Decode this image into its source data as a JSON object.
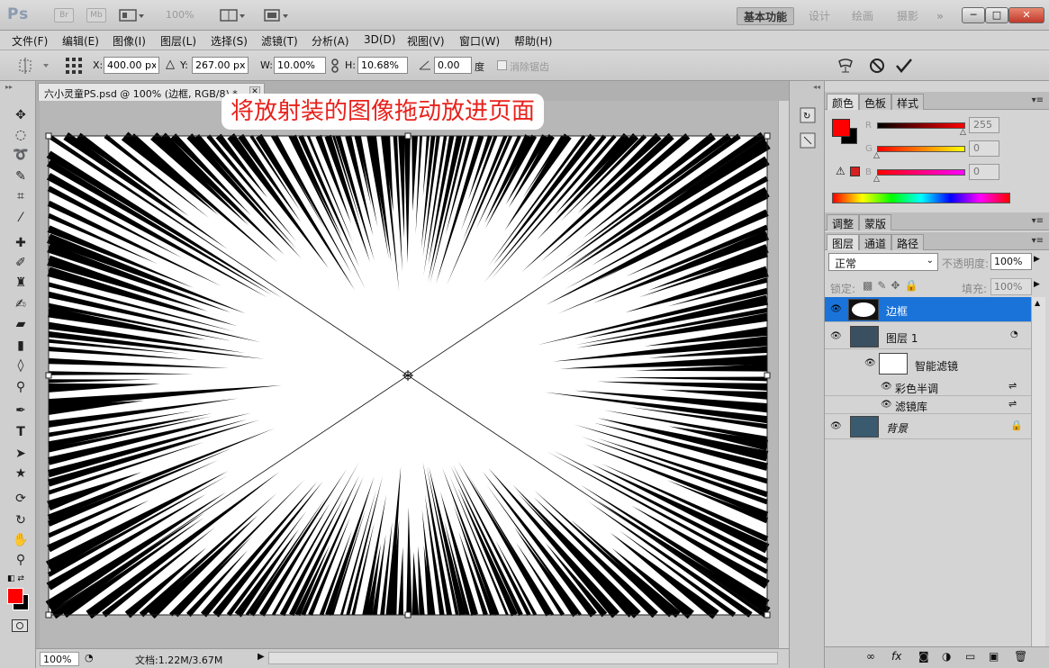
{
  "app": {
    "logo": "Ps",
    "bridge_label": "Br",
    "minibridge_label": "Mb",
    "zoom": "100%",
    "workspaces": [
      "基本功能",
      "设计",
      "绘画",
      "摄影"
    ],
    "more": "»",
    "win_min": "─",
    "win_max": "□",
    "win_close": "✕"
  },
  "menu": [
    "文件(F)",
    "编辑(E)",
    "图像(I)",
    "图层(L)",
    "选择(S)",
    "滤镜(T)",
    "分析(A)",
    "3D(D)",
    "视图(V)",
    "窗口(W)",
    "帮助(H)"
  ],
  "options": {
    "x_label": "X:",
    "x_value": "400.00 px",
    "y_label": "Y:",
    "y_value": "267.00 px",
    "w_label": "W:",
    "w_value": "10.00%",
    "h_label": "H:",
    "h_value": "10.68%",
    "angle_value": "0.00",
    "angle_unit": "度",
    "antialias_label": "消除锯齿"
  },
  "document": {
    "tab_title": "六小灵童PS.psd @ 100% (边框, RGB/8) *",
    "annotation": "将放射装的图像拖动放进页面",
    "status_zoom": "100%",
    "status_doc": "文档:1.22M/3.67M"
  },
  "color_panel": {
    "tabs": [
      "颜色",
      "色板",
      "样式"
    ],
    "r_label": "R",
    "g_label": "G",
    "b_label": "B",
    "r_value": "255",
    "g_value": "0",
    "b_value": "0",
    "foreground": "#ff0000",
    "background": "#000000"
  },
  "adjust_panel": {
    "tabs": [
      "调整",
      "蒙版"
    ]
  },
  "layers_panel": {
    "tabs": [
      "图层",
      "通道",
      "路径"
    ],
    "blend_mode": "正常",
    "opacity_label": "不透明度:",
    "opacity_value": "100%",
    "lock_label": "锁定:",
    "fill_label": "填充:",
    "fill_value": "100%",
    "layers": [
      {
        "name": "边框",
        "selected": true
      },
      {
        "name": "图层 1"
      },
      {
        "name": "智能滤镜"
      },
      {
        "name": "彩色半调"
      },
      {
        "name": "滤镜库"
      },
      {
        "name": "背景"
      }
    ]
  },
  "colors": {
    "selection": "#1a73d9",
    "annotation": "#e8211b"
  }
}
